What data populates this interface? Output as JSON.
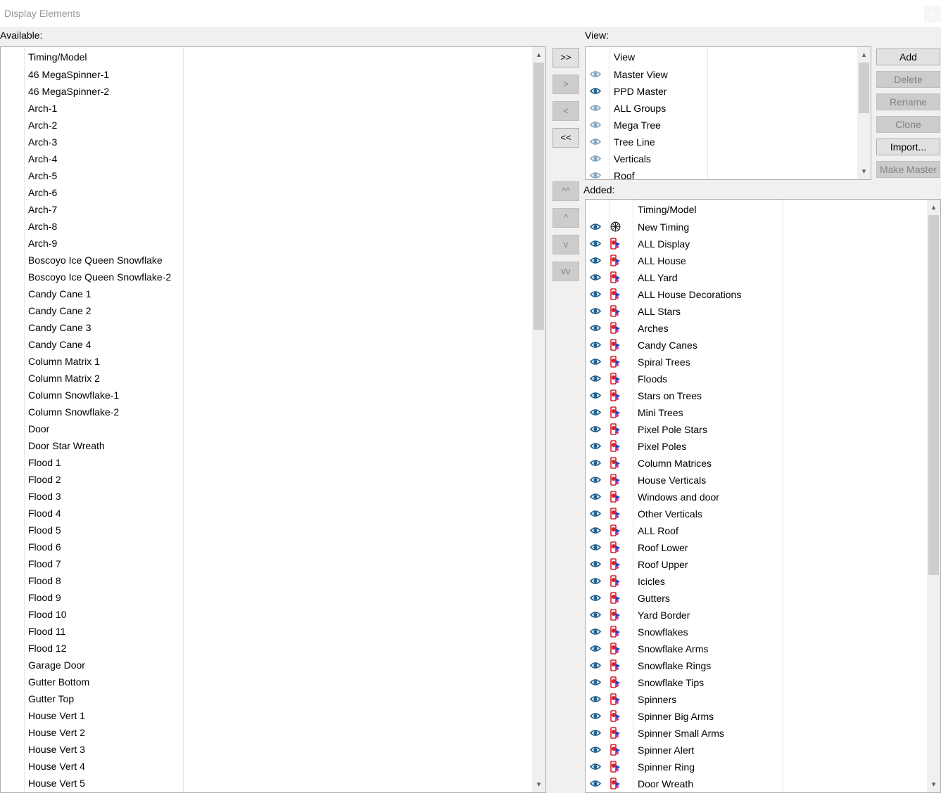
{
  "window": {
    "title": "Display Elements",
    "close_glyph": "×"
  },
  "available": {
    "label": "Available:",
    "header": "Timing/Model",
    "items": [
      "46 MegaSpinner-1",
      "46 MegaSpinner-2",
      "Arch-1",
      "Arch-2",
      "Arch-3",
      "Arch-4",
      "Arch-5",
      "Arch-6",
      "Arch-7",
      "Arch-8",
      "Arch-9",
      "Boscoyo Ice Queen Snowflake",
      "Boscoyo Ice Queen Snowflake-2",
      "Candy Cane 1",
      "Candy Cane 2",
      "Candy Cane 3",
      "Candy Cane 4",
      "Column Matrix 1",
      "Column Matrix 2",
      "Column Snowflake-1",
      "Column Snowflake-2",
      "Door",
      "Door Star Wreath",
      "Flood 1",
      "Flood 2",
      "Flood 3",
      "Flood 4",
      "Flood 5",
      "Flood 6",
      "Flood 7",
      "Flood 8",
      "Flood 9",
      "Flood 10",
      "Flood 11",
      "Flood 12",
      "Garage Door",
      "Gutter Bottom",
      "Gutter Top",
      "House Vert 1",
      "House Vert 2",
      "House Vert 3",
      "House Vert 4",
      "House Vert 5"
    ]
  },
  "transfer_buttons": [
    {
      "label": ">>",
      "enabled": true
    },
    {
      "label": ">",
      "enabled": false
    },
    {
      "label": "<",
      "enabled": false
    },
    {
      "label": "<<",
      "enabled": true
    }
  ],
  "order_buttons": [
    {
      "label": "^^",
      "enabled": false
    },
    {
      "label": "^",
      "enabled": false
    },
    {
      "label": "v",
      "enabled": false
    },
    {
      "label": "vv",
      "enabled": false
    }
  ],
  "view": {
    "label": "View:",
    "header": "View",
    "items": [
      {
        "name": "Master View",
        "visible": false
      },
      {
        "name": "PPD Master",
        "visible": true
      },
      {
        "name": "ALL Groups",
        "visible": false
      },
      {
        "name": "Mega Tree",
        "visible": false
      },
      {
        "name": "Tree Line",
        "visible": false
      },
      {
        "name": "Verticals",
        "visible": false
      },
      {
        "name": "Roof",
        "visible": false
      }
    ]
  },
  "view_buttons": [
    {
      "label": "Add",
      "enabled": true
    },
    {
      "label": "Delete",
      "enabled": false
    },
    {
      "label": "Rename",
      "enabled": false
    },
    {
      "label": "Clone",
      "enabled": false
    },
    {
      "label": "Import...",
      "enabled": true
    },
    {
      "label": "Make Master",
      "enabled": false
    }
  ],
  "added": {
    "label": "Added:",
    "header": "Timing/Model",
    "items": [
      {
        "name": "New Timing",
        "kind": "timing"
      },
      {
        "name": "ALL Display",
        "kind": "group"
      },
      {
        "name": "ALL House",
        "kind": "group"
      },
      {
        "name": "ALL Yard",
        "kind": "group"
      },
      {
        "name": "ALL House Decorations",
        "kind": "group"
      },
      {
        "name": "ALL Stars",
        "kind": "group"
      },
      {
        "name": "Arches",
        "kind": "group"
      },
      {
        "name": "Candy Canes",
        "kind": "group"
      },
      {
        "name": "Spiral Trees",
        "kind": "group"
      },
      {
        "name": "Floods",
        "kind": "group"
      },
      {
        "name": "Stars on Trees",
        "kind": "group"
      },
      {
        "name": "Mini Trees",
        "kind": "group"
      },
      {
        "name": "Pixel Pole Stars",
        "kind": "group"
      },
      {
        "name": "Pixel Poles",
        "kind": "group"
      },
      {
        "name": "Column Matrices",
        "kind": "group"
      },
      {
        "name": "House Verticals",
        "kind": "group"
      },
      {
        "name": "Windows and door",
        "kind": "group"
      },
      {
        "name": "Other Verticals",
        "kind": "group"
      },
      {
        "name": "ALL Roof",
        "kind": "group"
      },
      {
        "name": "Roof Lower",
        "kind": "group"
      },
      {
        "name": "Roof Upper",
        "kind": "group"
      },
      {
        "name": "Icicles",
        "kind": "group"
      },
      {
        "name": "Gutters",
        "kind": "group"
      },
      {
        "name": "Yard Border",
        "kind": "group"
      },
      {
        "name": "Snowflakes",
        "kind": "group"
      },
      {
        "name": "Snowflake Arms",
        "kind": "group"
      },
      {
        "name": "Snowflake Rings",
        "kind": "group"
      },
      {
        "name": "Snowflake Tips",
        "kind": "group"
      },
      {
        "name": "Spinners",
        "kind": "group"
      },
      {
        "name": "Spinner Big Arms",
        "kind": "group"
      },
      {
        "name": "Spinner Small Arms",
        "kind": "group"
      },
      {
        "name": "Spinner Alert",
        "kind": "group"
      },
      {
        "name": "Spinner Ring",
        "kind": "group"
      },
      {
        "name": "Door Wreath",
        "kind": "group"
      }
    ]
  },
  "icons": {
    "eye": "eye-icon",
    "group": "model-group-icon",
    "timing": "timing-clock-icon",
    "scroll_up": "▴",
    "scroll_down": "▾"
  },
  "colors": {
    "eye": "#1f5f8f",
    "group_red": "#d8202a",
    "group_blue": "#3040c0"
  }
}
